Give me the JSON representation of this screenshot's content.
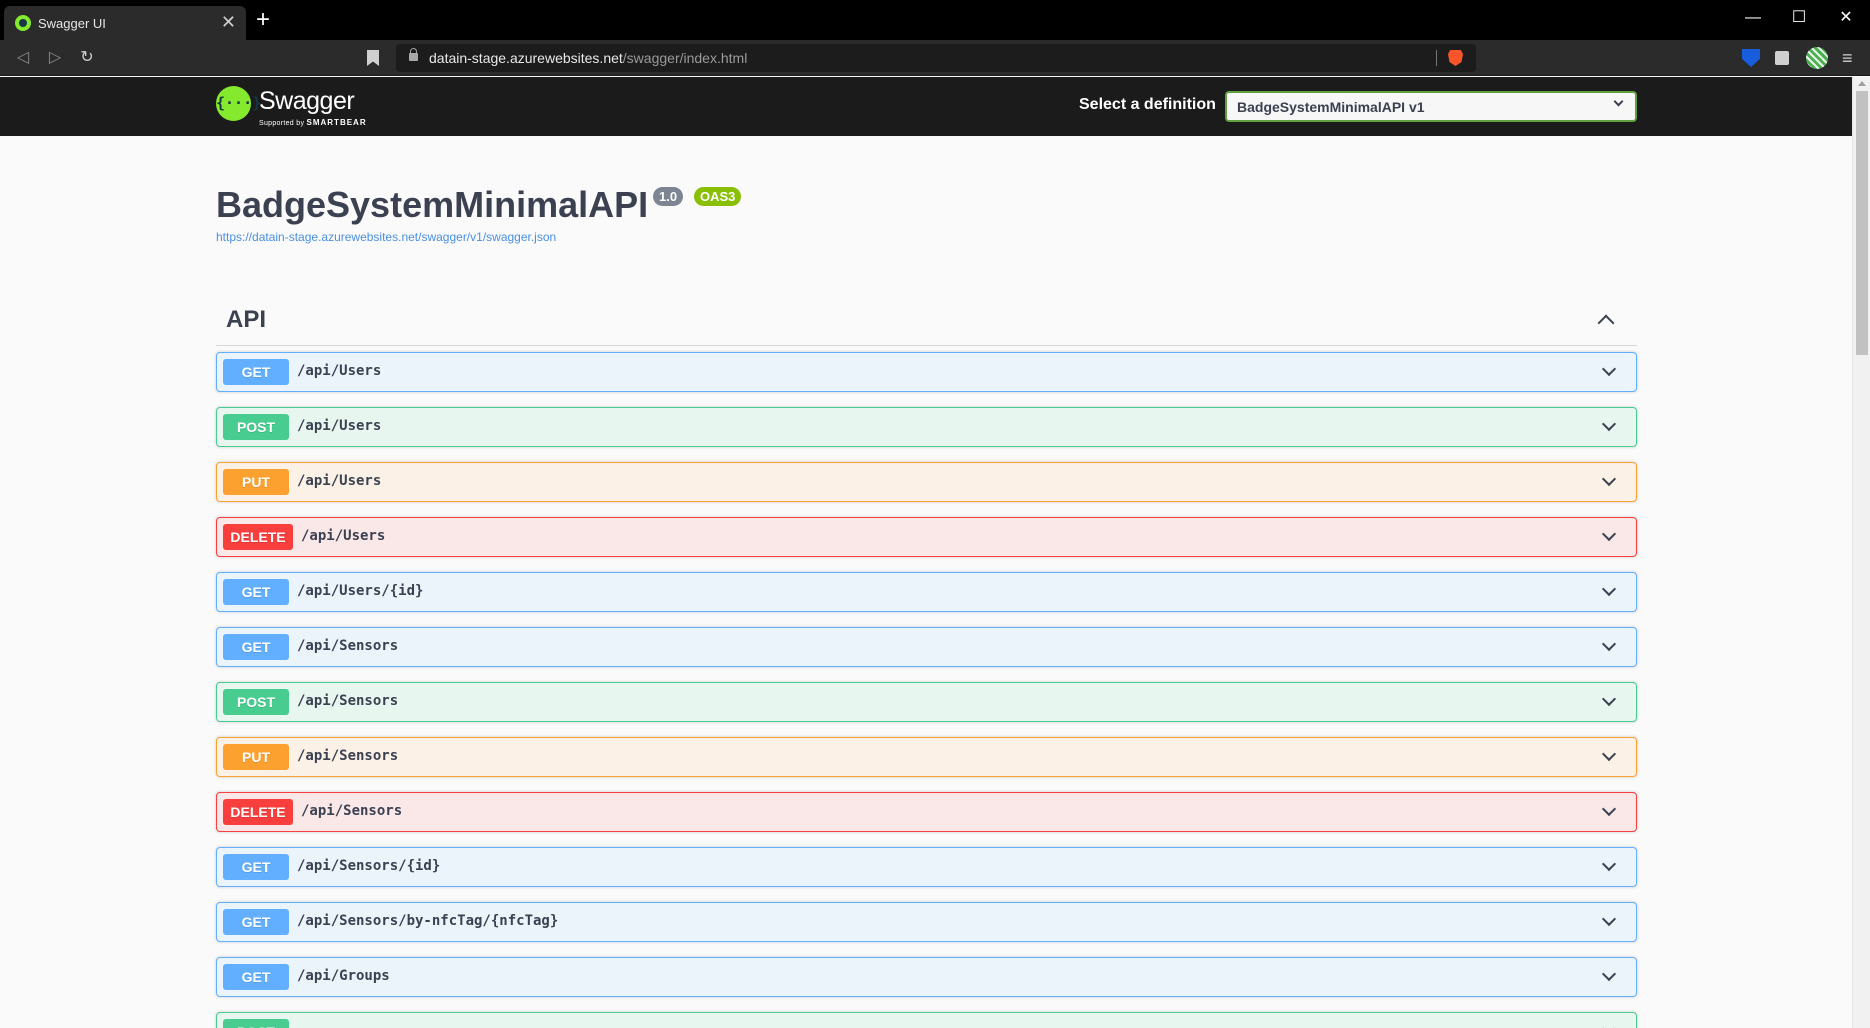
{
  "browser": {
    "tab_title": "Swagger UI",
    "tab_close": "✕",
    "new_tab": "+",
    "url_host": "datain-stage.azurewebsites.net",
    "url_path": "/swagger/index.html",
    "window_controls": {
      "minimize": "—",
      "maximize": "☐",
      "close": "✕"
    },
    "nav": {
      "back": "◁",
      "forward": "▷",
      "reload": "↻"
    },
    "menu": "≡"
  },
  "topbar": {
    "logo_word": "Swagger",
    "logo_symbol": "{···}",
    "logo_sub_prefix": "Supported by",
    "logo_sub_brand": "SMARTBEAR",
    "definition_label": "Select a definition",
    "definition_selected": "BadgeSystemMinimalAPI v1"
  },
  "info": {
    "title": "BadgeSystemMinimalAPI",
    "version": "1.0",
    "oas": "OAS3",
    "spec_url": "https://datain-stage.azurewebsites.net/swagger/v1/swagger.json"
  },
  "section": {
    "title": "API"
  },
  "operations": [
    {
      "method": "GET",
      "path": "/api/Users"
    },
    {
      "method": "POST",
      "path": "/api/Users"
    },
    {
      "method": "PUT",
      "path": "/api/Users"
    },
    {
      "method": "DELETE",
      "path": "/api/Users"
    },
    {
      "method": "GET",
      "path": "/api/Users/{id}"
    },
    {
      "method": "GET",
      "path": "/api/Sensors"
    },
    {
      "method": "POST",
      "path": "/api/Sensors"
    },
    {
      "method": "PUT",
      "path": "/api/Sensors"
    },
    {
      "method": "DELETE",
      "path": "/api/Sensors"
    },
    {
      "method": "GET",
      "path": "/api/Sensors/{id}"
    },
    {
      "method": "GET",
      "path": "/api/Sensors/by-nfcTag/{nfcTag}"
    },
    {
      "method": "GET",
      "path": "/api/Groups"
    },
    {
      "method": "POST",
      "path": ""
    }
  ],
  "colors": {
    "get": "#61affe",
    "post": "#49cc90",
    "put": "#fca130",
    "delete": "#f93e3e",
    "swagger_green": "#85ea2d",
    "topbar_bg": "#1b1b1b"
  }
}
